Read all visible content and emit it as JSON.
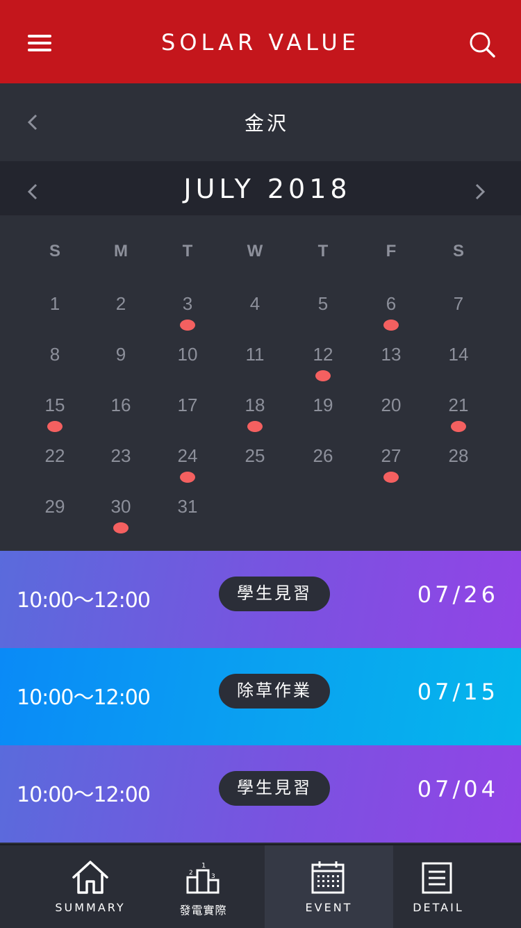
{
  "header": {
    "title": "SOLAR VALUE",
    "menu_icon": "hamburger-menu-icon",
    "search_icon": "search-icon",
    "bg_color": "#c4161c"
  },
  "location": {
    "name": "金沢",
    "back_icon": "chevron-left-icon"
  },
  "calendar": {
    "month_label": "JULY 2018",
    "weekdays": [
      "S",
      "M",
      "T",
      "W",
      "T",
      "F",
      "S"
    ],
    "weeks": [
      [
        "",
        "",
        "",
        "",
        "",
        "",
        ""
      ],
      [
        "1",
        "2",
        "3",
        "4",
        "5",
        "6",
        "7"
      ],
      [
        "8",
        "9",
        "10",
        "11",
        "12",
        "13",
        "14"
      ],
      [
        "15",
        "16",
        "17",
        "18",
        "19",
        "20",
        "21"
      ],
      [
        "22",
        "23",
        "24",
        "25",
        "26",
        "27",
        "28"
      ],
      [
        "29",
        "30",
        "31",
        "",
        "",
        "",
        ""
      ]
    ],
    "event_days": [
      "3",
      "6",
      "12",
      "15",
      "18",
      "21",
      "24",
      "27",
      "30"
    ],
    "event_dot_color": "#f46060"
  },
  "events": [
    {
      "time": "10:00〜12:00",
      "tag": "學生見習",
      "date": "07/26"
    },
    {
      "time": "10:00〜12:00",
      "tag": "除草作業",
      "date": "07/15"
    },
    {
      "time": "10:00〜12:00",
      "tag": "學生見習",
      "date": "07/04"
    }
  ],
  "tabbar": {
    "tabs": [
      {
        "label": "SUMMARY",
        "icon": "home-icon"
      },
      {
        "label": "發電實際",
        "icon": "podium-icon"
      },
      {
        "label": "EVENT",
        "icon": "calendar-icon",
        "active": true
      },
      {
        "label": "DETAIL",
        "icon": "document-icon"
      }
    ]
  }
}
